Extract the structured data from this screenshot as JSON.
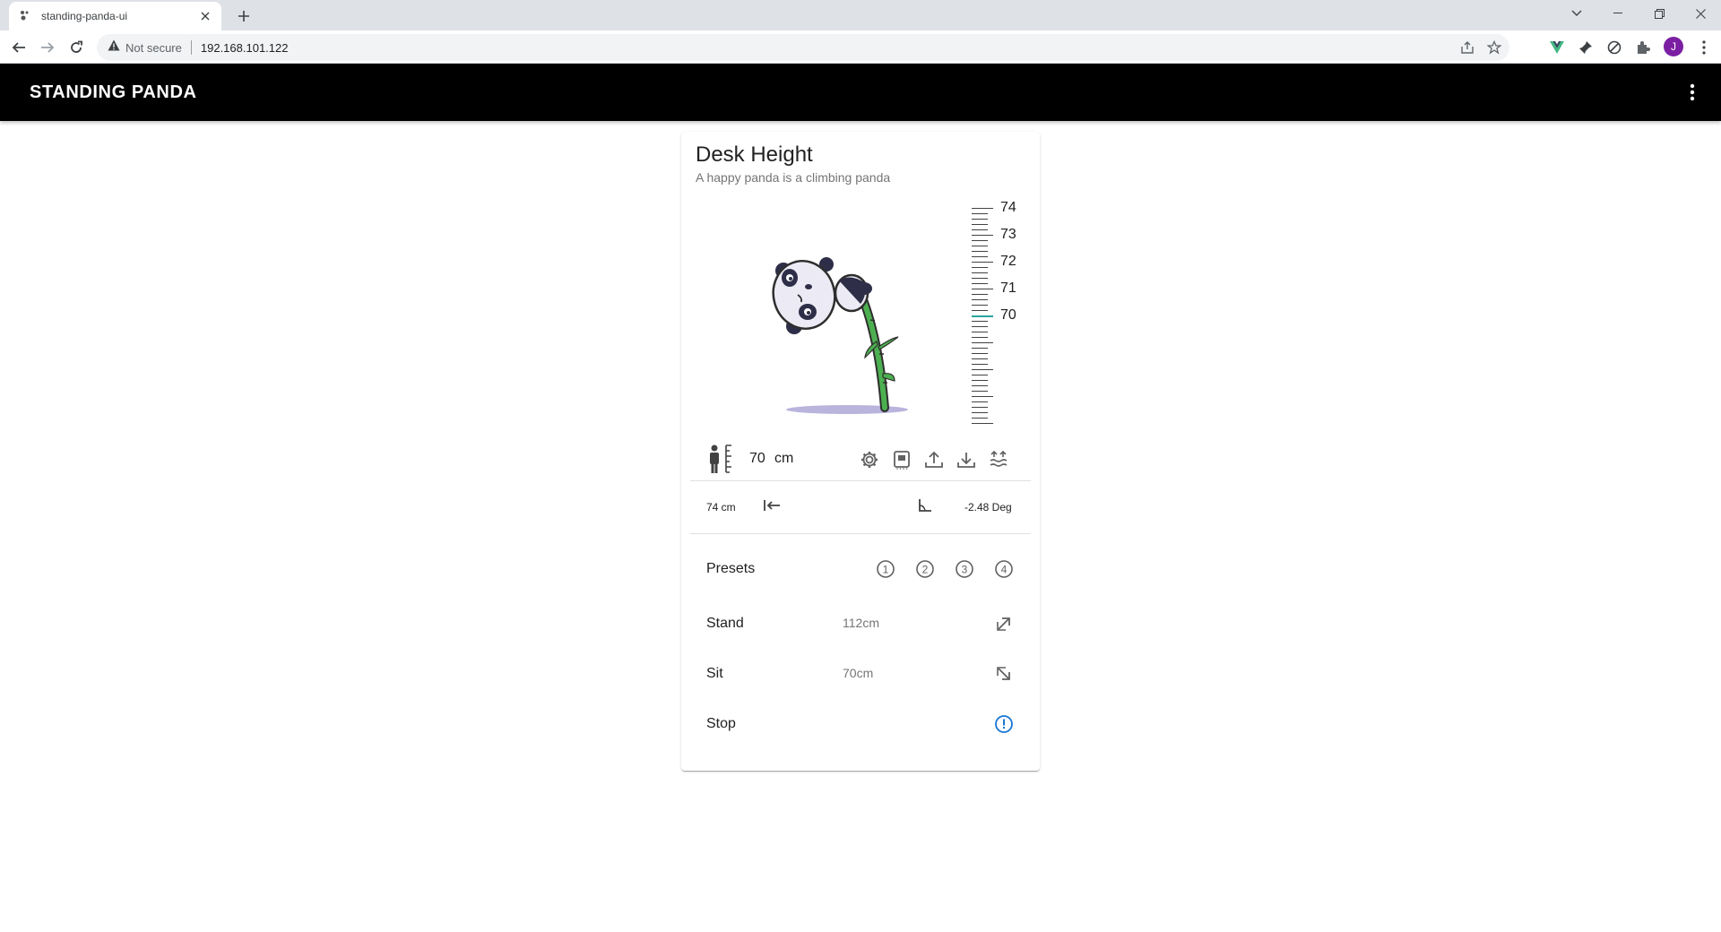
{
  "browser": {
    "tab_title": "standing-panda-ui",
    "security_label": "Not secure",
    "url": "192.168.101.122",
    "profile_initial": "J"
  },
  "app": {
    "title": "STANDING PANDA"
  },
  "card": {
    "title": "Desk Height",
    "subtitle": "A happy panda is a climbing panda"
  },
  "ruler": {
    "labels": [
      "74",
      "73",
      "72",
      "71",
      "70"
    ],
    "current_value": 70,
    "highlight_color": "#26a69a"
  },
  "height": {
    "value": "70",
    "unit": "cm",
    "actions": [
      "gear-icon",
      "save-icon",
      "upload-icon",
      "download-icon",
      "level-icon"
    ]
  },
  "info": {
    "max_height": "74 cm",
    "angle": "-2.48 Deg"
  },
  "presets": {
    "label": "Presets",
    "buttons": [
      "1",
      "2",
      "3",
      "4"
    ]
  },
  "rows": {
    "stand": {
      "label": "Stand",
      "value": "112cm"
    },
    "sit": {
      "label": "Sit",
      "value": "70cm"
    },
    "stop": {
      "label": "Stop"
    }
  },
  "colors": {
    "appbar": "#000000",
    "stop_icon": "#1976d2",
    "bamboo": "#4caf50"
  }
}
